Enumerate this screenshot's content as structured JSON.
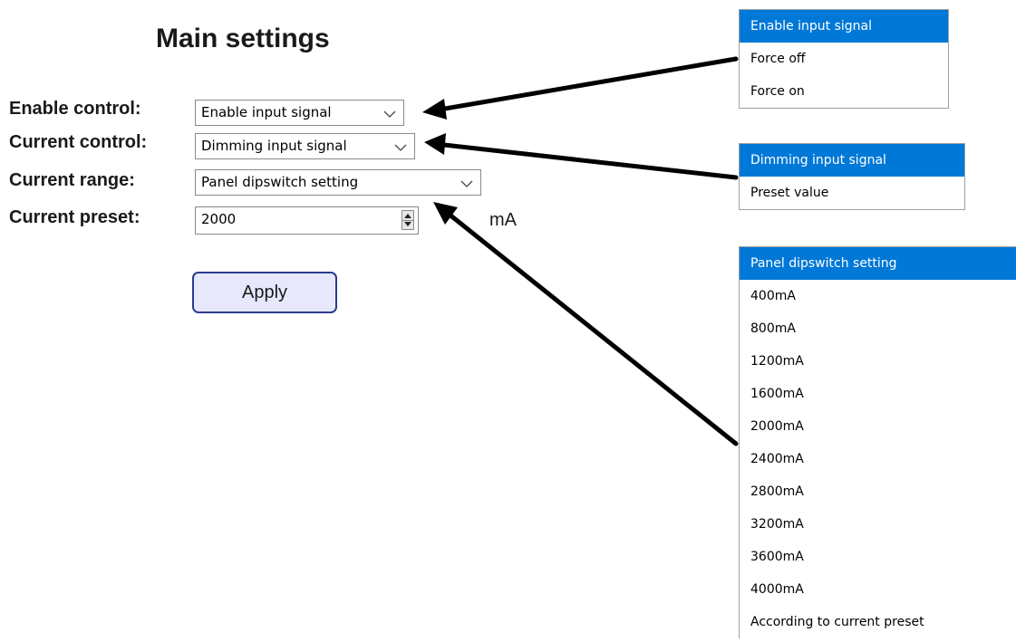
{
  "title": "Main settings",
  "rows": [
    {
      "label": "Enable control:",
      "value": "Enable input signal"
    },
    {
      "label": "Current control:",
      "value": "Dimming input signal"
    },
    {
      "label": "Current range:",
      "value": "Panel dipswitch setting"
    },
    {
      "label": "Current preset:",
      "value": "2000"
    }
  ],
  "unit": "mA",
  "apply_label": "Apply",
  "dropdowns": {
    "enable": [
      "Enable input signal",
      "Force off",
      "Force on"
    ],
    "current_control": [
      "Dimming input signal",
      "Preset value"
    ],
    "current_range": [
      "Panel dipswitch setting",
      "400mA",
      "800mA",
      "1200mA",
      "1600mA",
      "2000mA",
      "2400mA",
      "2800mA",
      "3200mA",
      "3600mA",
      "4000mA",
      "According to current preset"
    ]
  },
  "colors": {
    "selected": "#0078d7",
    "button_bg": "#e7e8fb",
    "button_border": "#2a3d8f"
  }
}
